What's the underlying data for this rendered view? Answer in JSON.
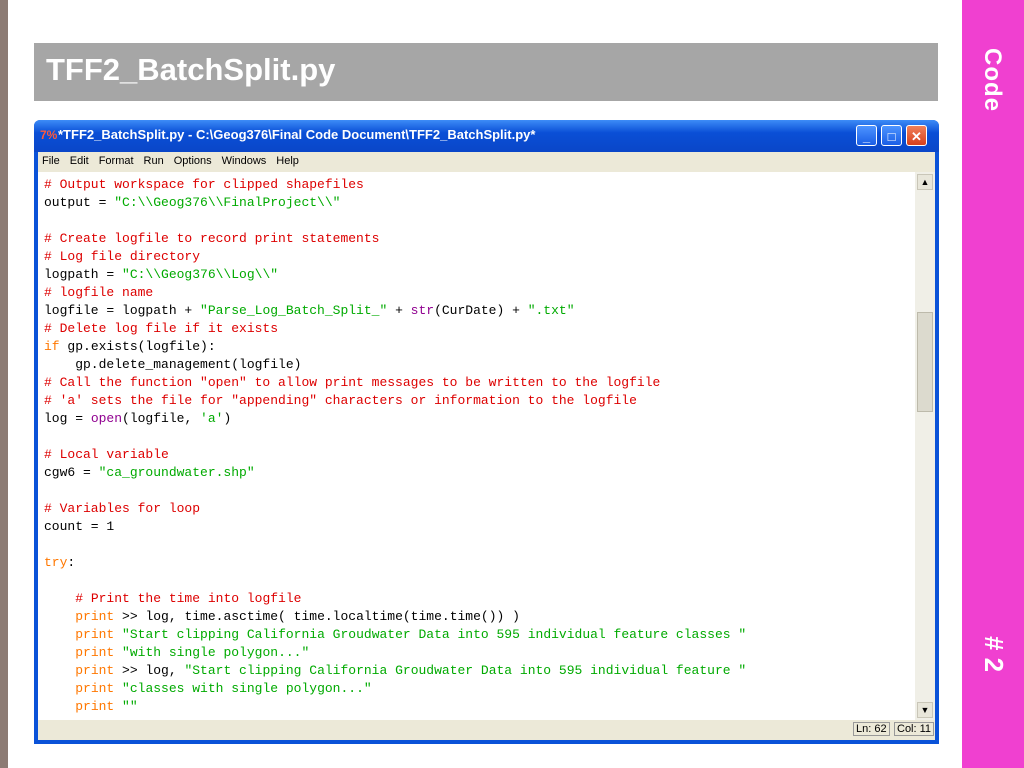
{
  "slide": {
    "title": "TFF2_BatchSplit.py",
    "band_label": "Code",
    "band_number": "# 2",
    "accent_color": "#f040d0",
    "title_bg": "#a6a6a6"
  },
  "window": {
    "icon": "idle-python-icon",
    "title": "*TFF2_BatchSplit.py - C:\\Geog376\\Final Code Document\\TFF2_BatchSplit.py*",
    "buttons": {
      "minimize": "minimize-icon",
      "maximize": "maximize-icon",
      "close": "close-icon"
    }
  },
  "menu": {
    "items": [
      "File",
      "Edit",
      "Format",
      "Run",
      "Options",
      "Windows",
      "Help"
    ]
  },
  "editor": {
    "lines": [
      "# Output workspace for clipped shapefiles",
      "output = \"C:\\\\Geog376\\\\FinalProject\\\\\"",
      "",
      "# Create logfile to record print statements",
      "# Log file directory",
      "logpath = \"C:\\\\Geog376\\\\Log\\\\\"",
      "# logfile name",
      "logfile = logpath + \"Parse_Log_Batch_Split_\" + str(CurDate) + \".txt\"",
      "# Delete log file if it exists",
      "if gp.exists(logfile):",
      "    gp.delete_management(logfile)",
      "# Call the function \"open\" to allow print messages to be written to the logfile",
      "# 'a' sets the file for \"appending\" characters or information to the logfile",
      "log = open(logfile, 'a')",
      "",
      "# Local variable",
      "cgw6 = \"ca_groundwater.shp\"",
      "",
      "# Variables for loop",
      "count = 1",
      "",
      "try:",
      "",
      "    # Print the time into logfile",
      "    print >> log, time.asctime( time.localtime(time.time()) )",
      "    print \"Start clipping California Groudwater Data into 595 individual feature classes \"",
      "    print \"with single polygon...\"",
      "    print >> log, \"Start clipping California Groudwater Data into 595 individual feature \"",
      "    print \"classes with single polygon...\"",
      "    print \"\""
    ]
  },
  "status": {
    "line": "Ln: 62",
    "col": "Col: 11"
  }
}
